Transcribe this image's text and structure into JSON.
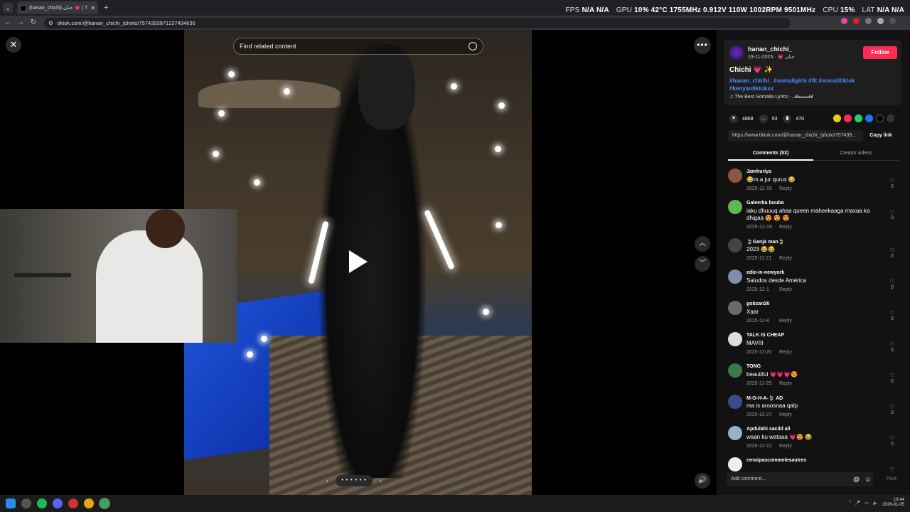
{
  "browser": {
    "tab_title": "(hanan_chichi) حنان 💗 | TikTok",
    "url": "tiktok.com/@hanan_chichi_/photo/7574393871237434636"
  },
  "overlay_stats": [
    {
      "label": "FPS",
      "value": "N/A  N/A"
    },
    {
      "label": "GPU",
      "value": "10% 42°C 1755MHz 0.912V 110W 1002RPM 9501MHz"
    },
    {
      "label": "CPU",
      "value": "15%"
    },
    {
      "label": "LAT",
      "value": "N/A  N/A"
    }
  ],
  "search": {
    "placeholder": "Find related content"
  },
  "post": {
    "username": "hanan_chichi_",
    "subline": "حنان 💗 · 2025-11-19",
    "follow_label": "Follow",
    "caption": "Chichi 💗 ✨",
    "hashtags": "#hanan_chichi_ #somaligirls #fit #somalitiktok #kenyantiktokxx",
    "music": "♫  The Best Somalia Lyrics - 𝓜𝓾𝓼𝓬𝓪𝓫𝓫",
    "likes": "4868",
    "comments": "53",
    "saves": "470",
    "link": "https://www.tiktok.com/@hanan_chichi_/photo/757439...",
    "copy_link": "Copy link",
    "tab_comments": "Comments (53)",
    "tab_creator": "Creator videos"
  },
  "comments": [
    {
      "name": "Jamhuriya",
      "text": "😂m.a jur qurux 😂",
      "date": "2025-12-15",
      "likes": "0",
      "avatar_color": "#8a5a3a"
    },
    {
      "name": "Galeerka buuba",
      "text": "iaku dhuuuq ahaa queen maheekaaga maxaa ka dhigaa 😍 😍 😍",
      "date": "2025-12-19",
      "likes": "0",
      "avatar_color": "#5cb85c"
    },
    {
      "name": "🍃Ganja man🍃",
      "text": "2023 😂😂",
      "date": "2025-11-21",
      "likes": "0",
      "avatar_color": "#444444"
    },
    {
      "name": "edie-in-newyork",
      "text": "Saludos desde América",
      "date": "2025-12-1",
      "likes": "0",
      "avatar_color": "#7f8fa8"
    },
    {
      "name": "gobzan26",
      "text": "Xaar",
      "date": "2025-12-8",
      "likes": "0",
      "avatar_color": "#6a6a6a"
    },
    {
      "name": "TALK IS CHEAP",
      "text": "MAVIII",
      "date": "2025-11-20",
      "likes": "3",
      "avatar_color": "#dddddd"
    },
    {
      "name": "TONG",
      "text": "beautiful 💗💗💗😍",
      "date": "2025-11-29",
      "likes": "0",
      "avatar_color": "#3a7a4a"
    },
    {
      "name": "M-O-H-A-🍃 AD",
      "text": "ma is aroosnaa qalp",
      "date": "2025-12-27",
      "likes": "0",
      "avatar_color": "#3a4a8a"
    },
    {
      "name": "Apdulahi saciid ali",
      "text": "waan ku wataaa 💗😍 😂",
      "date": "2025-12-21",
      "likes": "0",
      "avatar_color": "#9ab0c8"
    },
    {
      "name": "renoipascommelesautres",
      "text": "",
      "date": "",
      "likes": "",
      "avatar_color": "#eeeeee"
    }
  ],
  "reply_label": "Reply",
  "add_comment_placeholder": "Add comment...",
  "post_label": "Post",
  "carousel_label": "• • • • • •",
  "clock": {
    "time": "18:44",
    "date": "2026-01-05"
  },
  "colors": {
    "accent": "#fe2c55",
    "hashtag": "#4d8fff"
  }
}
